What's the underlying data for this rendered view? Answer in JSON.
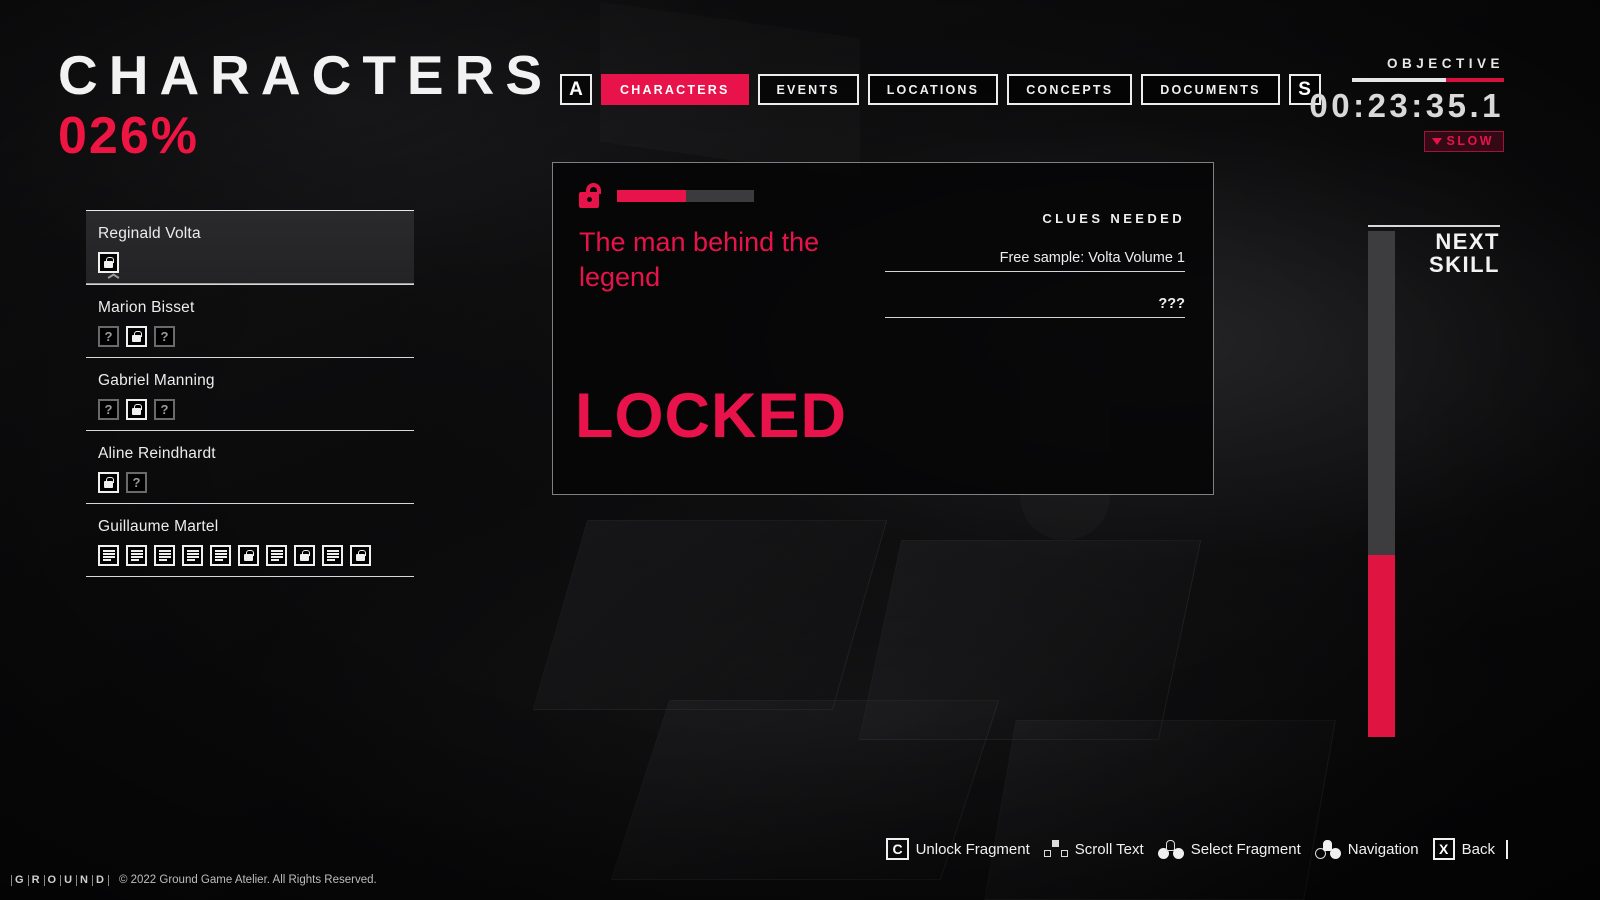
{
  "header": {
    "title": "CHARACTERS",
    "percent": "026%"
  },
  "tabs": {
    "prev_key": "A",
    "next_key": "S",
    "items": [
      {
        "label": "CHARACTERS",
        "active": true
      },
      {
        "label": "EVENTS",
        "active": false
      },
      {
        "label": "LOCATIONS",
        "active": false
      },
      {
        "label": "CONCEPTS",
        "active": false
      },
      {
        "label": "DOCUMENTS",
        "active": false
      }
    ]
  },
  "objective": {
    "label": "OBJECTIVE",
    "time": "00:23:35.1",
    "status_badge": "SLOW",
    "bar_white_percent": 62
  },
  "characters": [
    {
      "name": "Reginald Volta",
      "selected": true,
      "fragments": [
        {
          "type": "lock",
          "state": "bright"
        }
      ]
    },
    {
      "name": "Marion Bisset",
      "selected": false,
      "fragments": [
        {
          "type": "question",
          "state": "dim"
        },
        {
          "type": "lock",
          "state": "bright"
        },
        {
          "type": "question",
          "state": "dim"
        }
      ]
    },
    {
      "name": "Gabriel Manning",
      "selected": false,
      "fragments": [
        {
          "type": "question",
          "state": "dim"
        },
        {
          "type": "lock",
          "state": "bright"
        },
        {
          "type": "question",
          "state": "dim"
        }
      ]
    },
    {
      "name": "Aline Reindhardt",
      "selected": false,
      "fragments": [
        {
          "type": "lock",
          "state": "bright"
        },
        {
          "type": "question",
          "state": "dim"
        }
      ]
    },
    {
      "name": "Guillaume Martel",
      "selected": false,
      "fragments": [
        {
          "type": "doc",
          "state": "bright"
        },
        {
          "type": "doc",
          "state": "bright"
        },
        {
          "type": "doc",
          "state": "bright"
        },
        {
          "type": "doc",
          "state": "bright"
        },
        {
          "type": "doc",
          "state": "bright"
        },
        {
          "type": "lock",
          "state": "bright"
        },
        {
          "type": "doc",
          "state": "bright"
        },
        {
          "type": "lock",
          "state": "bright"
        },
        {
          "type": "doc",
          "state": "bright"
        },
        {
          "type": "lock",
          "state": "bright"
        }
      ]
    }
  ],
  "fragment_panel": {
    "progress_percent": 50,
    "heading": "The man behind the legend",
    "status": "LOCKED",
    "clues_title": "CLUES NEEDED",
    "clues": [
      "Free sample: Volta Volume 1",
      "???"
    ]
  },
  "next_skill": {
    "label_line1": "NEXT",
    "label_line2": "SKILL",
    "fill_percent": 36
  },
  "hints": [
    {
      "icon": "key-c",
      "key": "C",
      "label": "Unlock Fragment"
    },
    {
      "icon": "dpad-icon",
      "key": "",
      "label": "Scroll Text"
    },
    {
      "icon": "left-stick-icon",
      "key": "",
      "label": "Select Fragment"
    },
    {
      "icon": "right-stick-icon",
      "key": "",
      "label": "Navigation"
    },
    {
      "icon": "key-x",
      "key": "X",
      "label": "Back"
    }
  ],
  "footer": {
    "logo_letters": [
      "G",
      "R",
      "O",
      "U",
      "N",
      "D"
    ],
    "copyright": "© 2022 Ground Game Atelier. All Rights Reserved."
  },
  "colors": {
    "accent": "#e8134a",
    "panel_border": "#7f7f84",
    "text": "#f0f0f0"
  }
}
